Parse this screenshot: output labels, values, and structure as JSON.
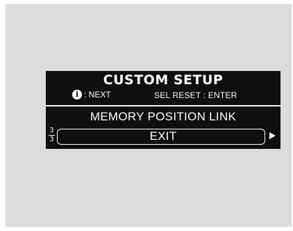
{
  "screen": {
    "title": "CUSTOM SETUP",
    "hint_next_icon": "info-icon",
    "hint_next_label": ": NEXT",
    "hint_reset": "SEL RESET : ENTER",
    "menu_items": [
      "MEMORY POSITION LINK",
      "EXIT"
    ],
    "page_current": "3",
    "page_total": "3",
    "arrow_icon": "right-arrow-icon"
  },
  "colors": {
    "background": "#dcdcdc",
    "screen": "#0f0f0f",
    "text": "#ffffff"
  }
}
